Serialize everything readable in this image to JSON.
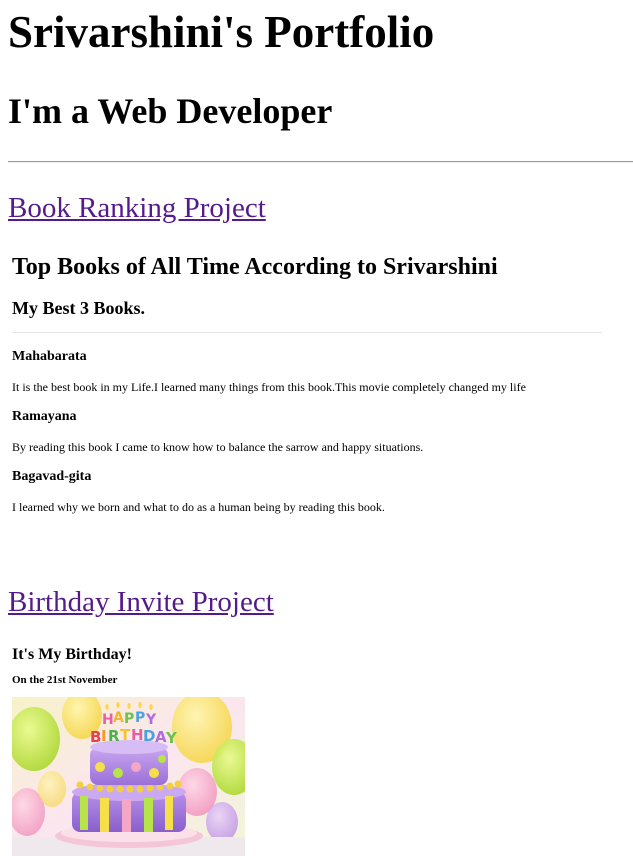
{
  "header": {
    "title": "Srivarshini's Portfolio",
    "subtitle": "I'm a Web Developer"
  },
  "projects": [
    {
      "link_label": "Book Ranking Project",
      "content": {
        "title": "Top Books of All Time According to Srivarshini",
        "subtitle": "My Best 3 Books.",
        "books": [
          {
            "name": "Mahabarata",
            "description": "It is the best book in my Life.I learned many things from this book.This movie completely changed my life"
          },
          {
            "name": "Ramayana",
            "description": "By reading this book I came to know how to balance the sarrow and happy situations."
          },
          {
            "name": "Bagavad-gita",
            "description": "I learned why we born and what to do as a human being by reading this book."
          }
        ]
      }
    },
    {
      "link_label": "Birthday Invite Project",
      "content": {
        "title": "It's My Birthday!",
        "date": "On the 21st November",
        "image_icon": "birthday-cake-icon",
        "cake_text": "HAPPY BIRTHDAY"
      }
    }
  ],
  "colors": {
    "visited_link": "#551a8b",
    "text": "#000000",
    "background": "#ffffff"
  }
}
